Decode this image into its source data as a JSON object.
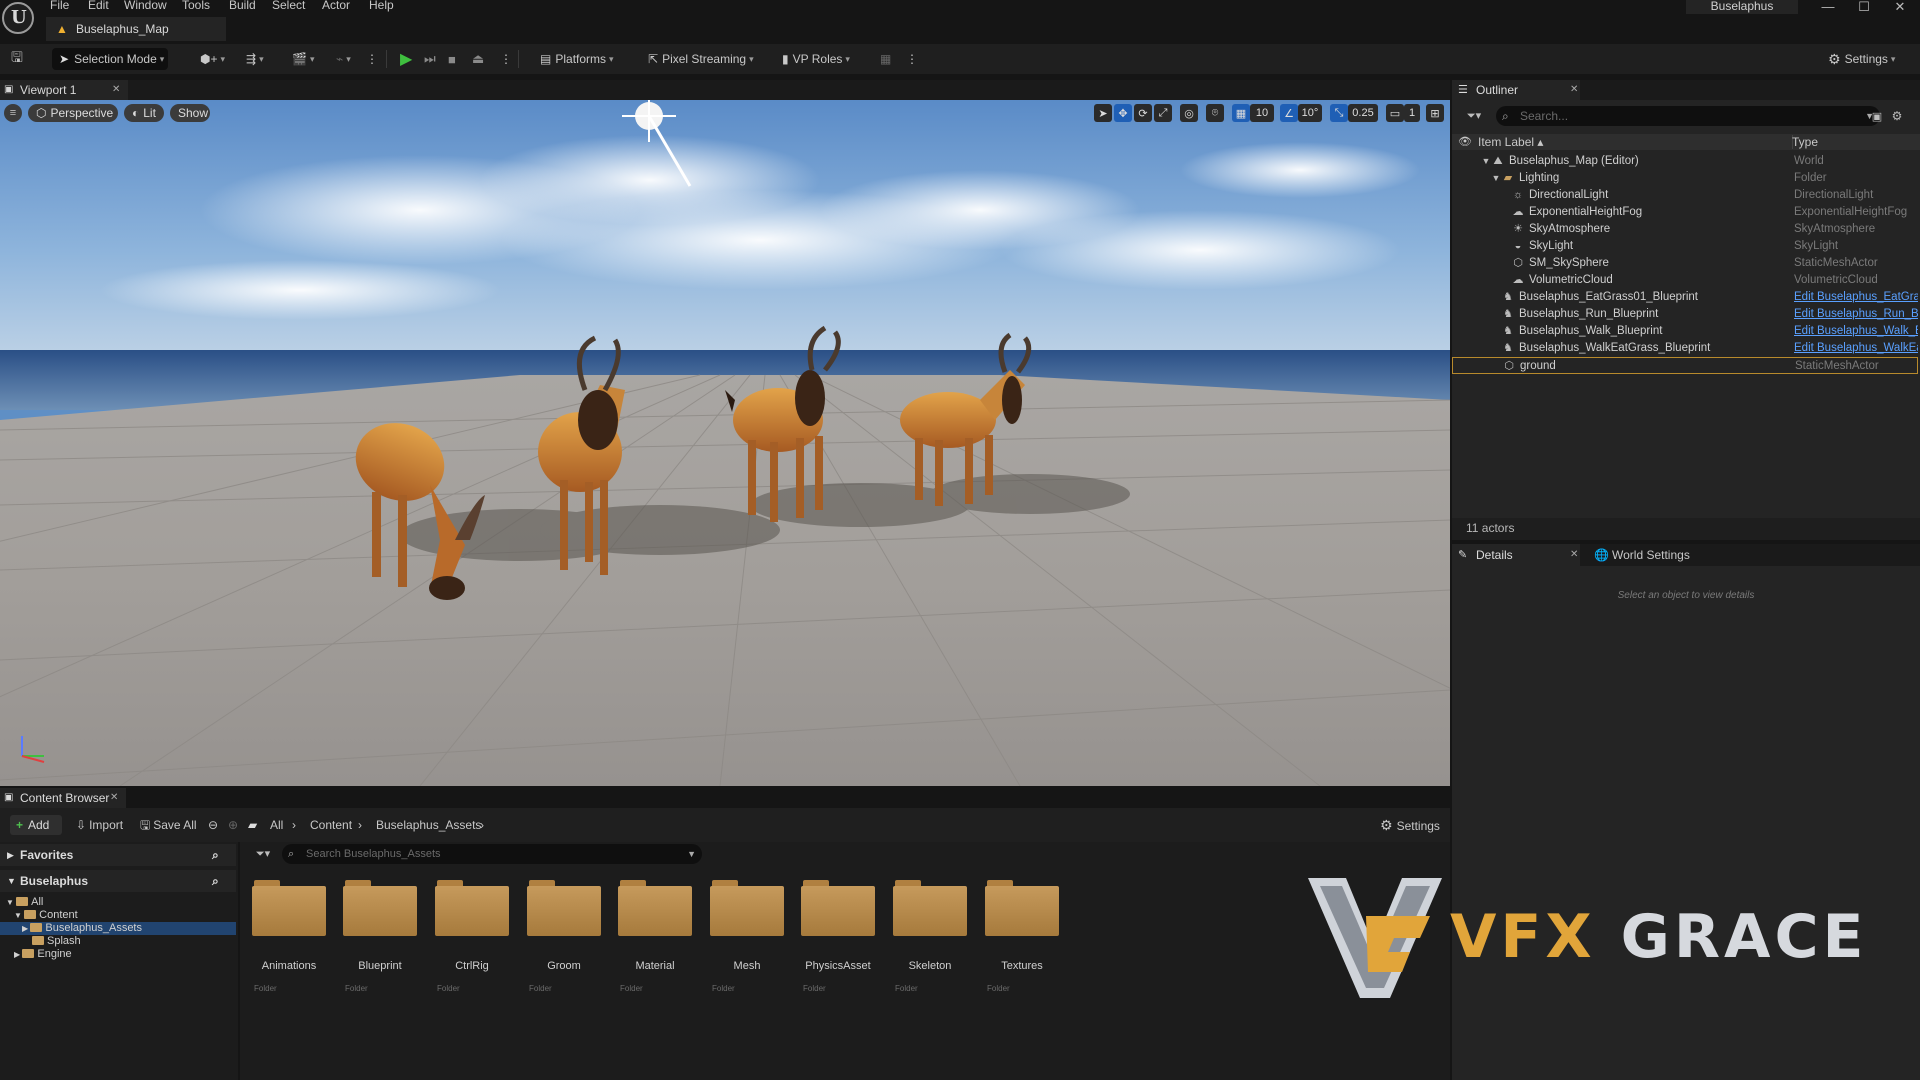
{
  "app": {
    "menu": [
      "File",
      "Edit",
      "Window",
      "Tools",
      "Build",
      "Select",
      "Actor",
      "Help"
    ],
    "project_name": "Buselaphus",
    "document_tab": "Buselaphus_Map"
  },
  "toolbar": {
    "selection_mode": "Selection Mode",
    "platforms": "Platforms",
    "pixel_streaming": "Pixel Streaming",
    "vp_roles": "VP Roles",
    "settings": "Settings"
  },
  "viewport": {
    "tab": "Viewport 1",
    "perspective": "Perspective",
    "lit": "Lit",
    "show": "Show",
    "grid_snap": "10",
    "rotation_snap": "10°",
    "scale_snap": "0.25",
    "camera_speed": "1"
  },
  "outliner": {
    "tab": "Outliner",
    "search_placeholder": "Search...",
    "col_label": "Item Label ▴",
    "col_type": "Type",
    "rows": [
      {
        "label": "Buselaphus_Map (Editor)",
        "type": "World"
      },
      {
        "label": "Lighting",
        "type": "Folder"
      },
      {
        "label": "DirectionalLight",
        "type": "DirectionalLight"
      },
      {
        "label": "ExponentialHeightFog",
        "type": "ExponentialHeightFog"
      },
      {
        "label": "SkyAtmosphere",
        "type": "SkyAtmosphere"
      },
      {
        "label": "SkyLight",
        "type": "SkyLight"
      },
      {
        "label": "SM_SkySphere",
        "type": "StaticMeshActor"
      },
      {
        "label": "VolumetricCloud",
        "type": "VolumetricCloud"
      },
      {
        "label": "Buselaphus_EatGrass01_Blueprint",
        "type": "Edit Buselaphus_EatGras"
      },
      {
        "label": "Buselaphus_Run_Blueprint",
        "type": "Edit Buselaphus_Run_Bl"
      },
      {
        "label": "Buselaphus_Walk_Blueprint",
        "type": "Edit Buselaphus_Walk_B"
      },
      {
        "label": "Buselaphus_WalkEatGrass_Blueprint",
        "type": "Edit Buselaphus_WalkEa"
      },
      {
        "label": "ground",
        "type": "StaticMeshActor"
      }
    ],
    "actor_count": "11 actors"
  },
  "details": {
    "tab": "Details",
    "world_settings_tab": "World Settings",
    "empty_text": "Select an object to view details"
  },
  "content_browser": {
    "tab": "Content Browser",
    "add": "Add",
    "import": "Import",
    "save_all": "Save All",
    "breadcrumb": [
      "All",
      "Content",
      "Buselaphus_Assets"
    ],
    "settings": "Settings",
    "favorites": "Favorites",
    "project_section": "Buselaphus",
    "tree": [
      "All",
      "Content",
      "Buselaphus_Assets",
      "Splash",
      "Engine"
    ],
    "search_placeholder": "Search Buselaphus_Assets",
    "folders": [
      {
        "name": "Animations",
        "kind": "Folder"
      },
      {
        "name": "Blueprint",
        "kind": "Folder"
      },
      {
        "name": "CtrlRig",
        "kind": "Folder"
      },
      {
        "name": "Groom",
        "kind": "Folder"
      },
      {
        "name": "Material",
        "kind": "Folder"
      },
      {
        "name": "Mesh",
        "kind": "Folder"
      },
      {
        "name": "PhysicsAsset",
        "kind": "Folder"
      },
      {
        "name": "Skeleton",
        "kind": "Folder"
      },
      {
        "name": "Textures",
        "kind": "Folder"
      }
    ]
  },
  "watermark": {
    "part1": "VFX",
    "part2": "GRACE"
  }
}
